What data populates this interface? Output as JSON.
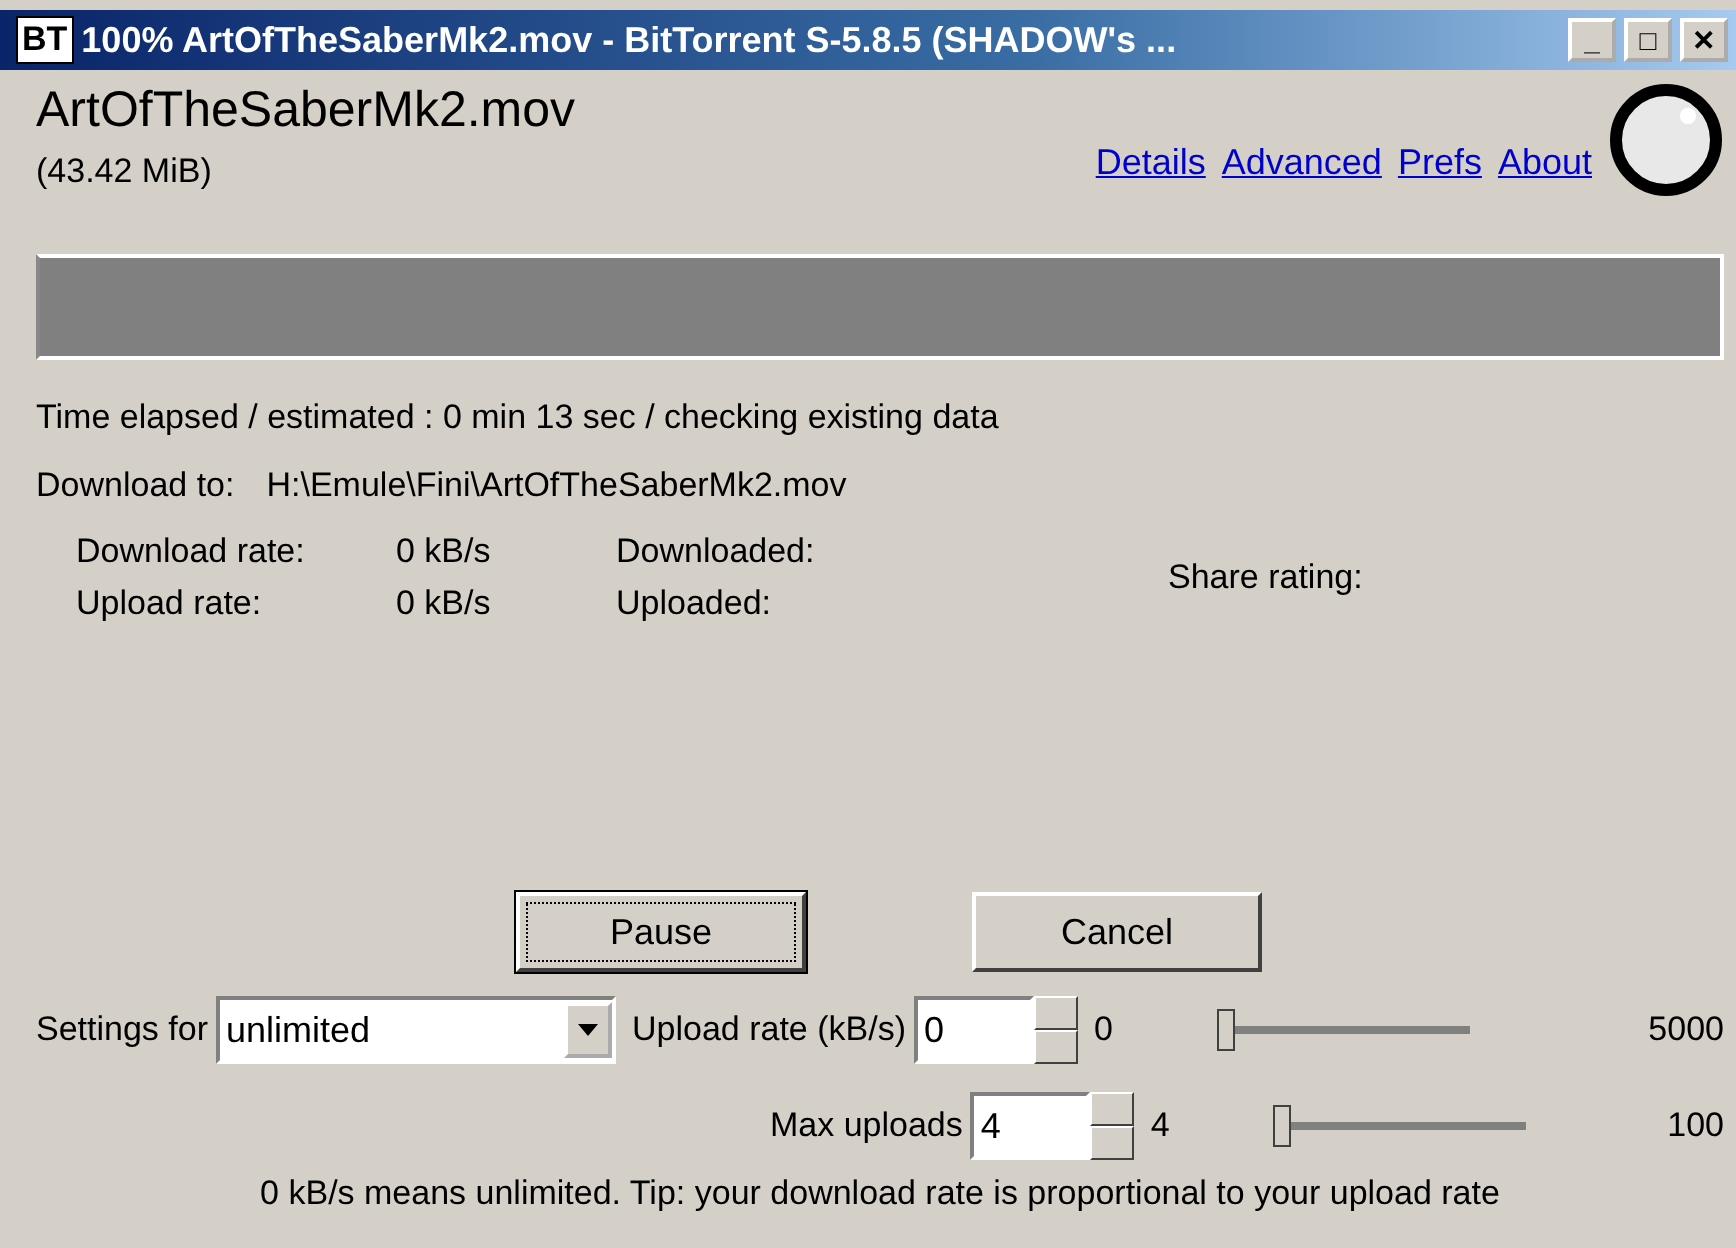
{
  "window": {
    "icon_text": "BT",
    "title": "100% ArtOfTheSaberMk2.mov - BitTorrent S-5.8.5 (SHADOW's ...",
    "controls": [
      "_",
      "□",
      "✕"
    ]
  },
  "file": {
    "name": "ArtOfTheSaberMk2.mov",
    "size": "(43.42 MiB)"
  },
  "links": [
    "Details",
    "Advanced",
    "Prefs",
    "About"
  ],
  "progress": {
    "level": 0
  },
  "time_line": "Time elapsed / estimated : 0 min 13 sec / checking existing data",
  "download_to": {
    "label": "Download to:",
    "path": "H:\\Emule\\Fini\\ArtOfTheSaberMk2.mov"
  },
  "stats": {
    "download_rate_label": "Download rate:",
    "download_rate": "0 kB/s",
    "upload_rate_label": "Upload rate:",
    "upload_rate": "0 kB/s",
    "downloaded_label": "Downloaded:",
    "uploaded_label": "Uploaded:",
    "share_rating_label": "Share rating:"
  },
  "buttons": [
    {
      "label": "Pause",
      "focused": true
    },
    {
      "label": "Cancel",
      "focused": false
    }
  ],
  "settings": {
    "label": "Settings for",
    "value": "unlimited"
  },
  "rows": [
    {
      "label": "Upload rate (kB/s)",
      "value": "0",
      "reading": "0",
      "level": 0,
      "max": "5000"
    },
    {
      "label": "Max uploads",
      "value": "4",
      "reading": "4",
      "level": 0,
      "max": "100"
    }
  ],
  "tip": "0 kB/s means unlimited. Tip: your download rate is proportional to your upload rate"
}
